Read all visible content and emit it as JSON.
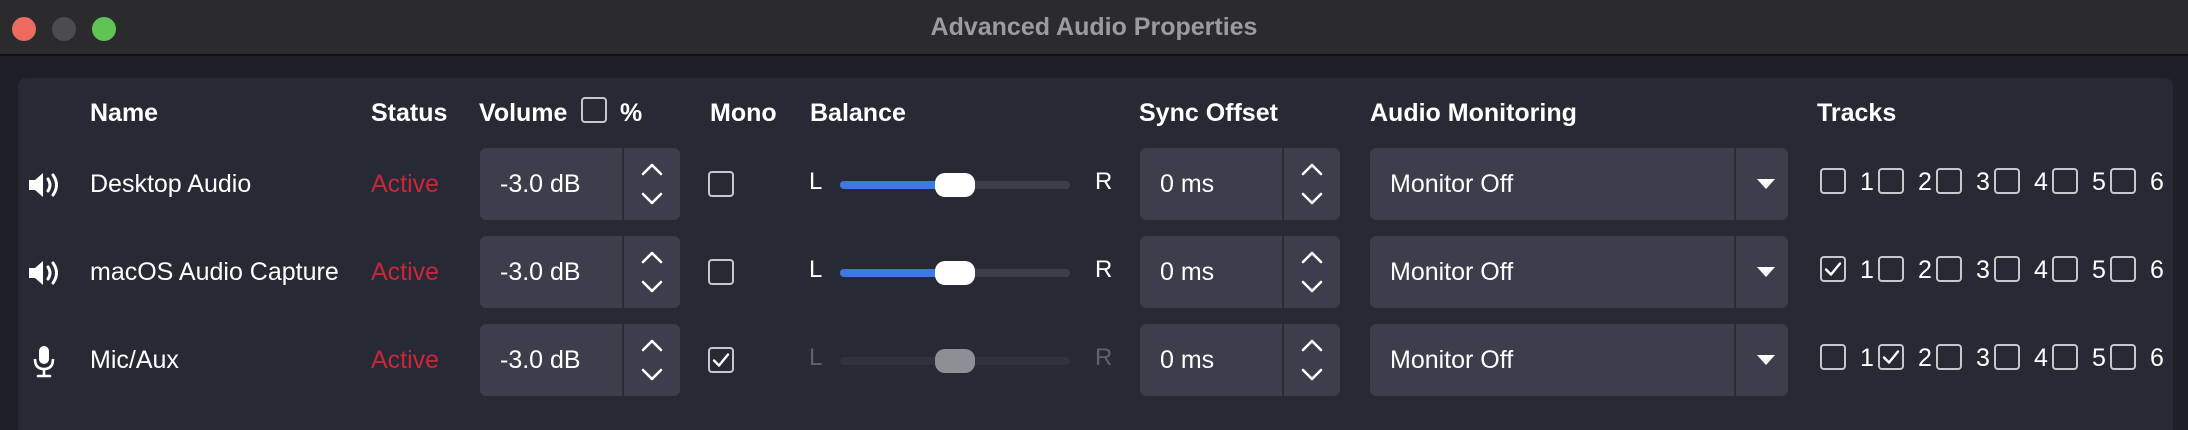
{
  "window": {
    "title": "Advanced Audio Properties"
  },
  "headers": {
    "name": "Name",
    "status": "Status",
    "volume": "Volume",
    "volume_percent": "%",
    "mono": "Mono",
    "balance": "Balance",
    "sync_offset": "Sync Offset",
    "audio_monitoring": "Audio Monitoring",
    "tracks": "Tracks"
  },
  "balance_labels": {
    "left": "L",
    "right": "R"
  },
  "colors": {
    "status_active": "#c9263b",
    "slider_fill": "#3e78e3",
    "background": "#1d1e26",
    "panel": "#272a34"
  },
  "rows": [
    {
      "icon": "speaker-icon",
      "name": "Desktop Audio",
      "status": "Active",
      "volume": "-3.0 dB",
      "mono": false,
      "balance": 0.5,
      "balance_enabled": true,
      "sync_offset": "0 ms",
      "monitoring": "Monitor Off",
      "tracks": [
        {
          "label": "1",
          "checked": false
        },
        {
          "label": "2",
          "checked": false
        },
        {
          "label": "3",
          "checked": false
        },
        {
          "label": "4",
          "checked": false
        },
        {
          "label": "5",
          "checked": false
        },
        {
          "label": "6",
          "checked": false
        }
      ]
    },
    {
      "icon": "speaker-icon",
      "name": "macOS Audio Capture",
      "status": "Active",
      "volume": "-3.0 dB",
      "mono": false,
      "balance": 0.5,
      "balance_enabled": true,
      "sync_offset": "0 ms",
      "monitoring": "Monitor Off",
      "tracks": [
        {
          "label": "1",
          "checked": true
        },
        {
          "label": "2",
          "checked": false
        },
        {
          "label": "3",
          "checked": false
        },
        {
          "label": "4",
          "checked": false
        },
        {
          "label": "5",
          "checked": false
        },
        {
          "label": "6",
          "checked": false
        }
      ]
    },
    {
      "icon": "microphone-icon",
      "name": "Mic/Aux",
      "status": "Active",
      "volume": "-3.0 dB",
      "mono": true,
      "balance": 0.5,
      "balance_enabled": false,
      "sync_offset": "0 ms",
      "monitoring": "Monitor Off",
      "tracks": [
        {
          "label": "1",
          "checked": false
        },
        {
          "label": "2",
          "checked": true
        },
        {
          "label": "3",
          "checked": false
        },
        {
          "label": "4",
          "checked": false
        },
        {
          "label": "5",
          "checked": false
        },
        {
          "label": "6",
          "checked": false
        }
      ]
    }
  ]
}
